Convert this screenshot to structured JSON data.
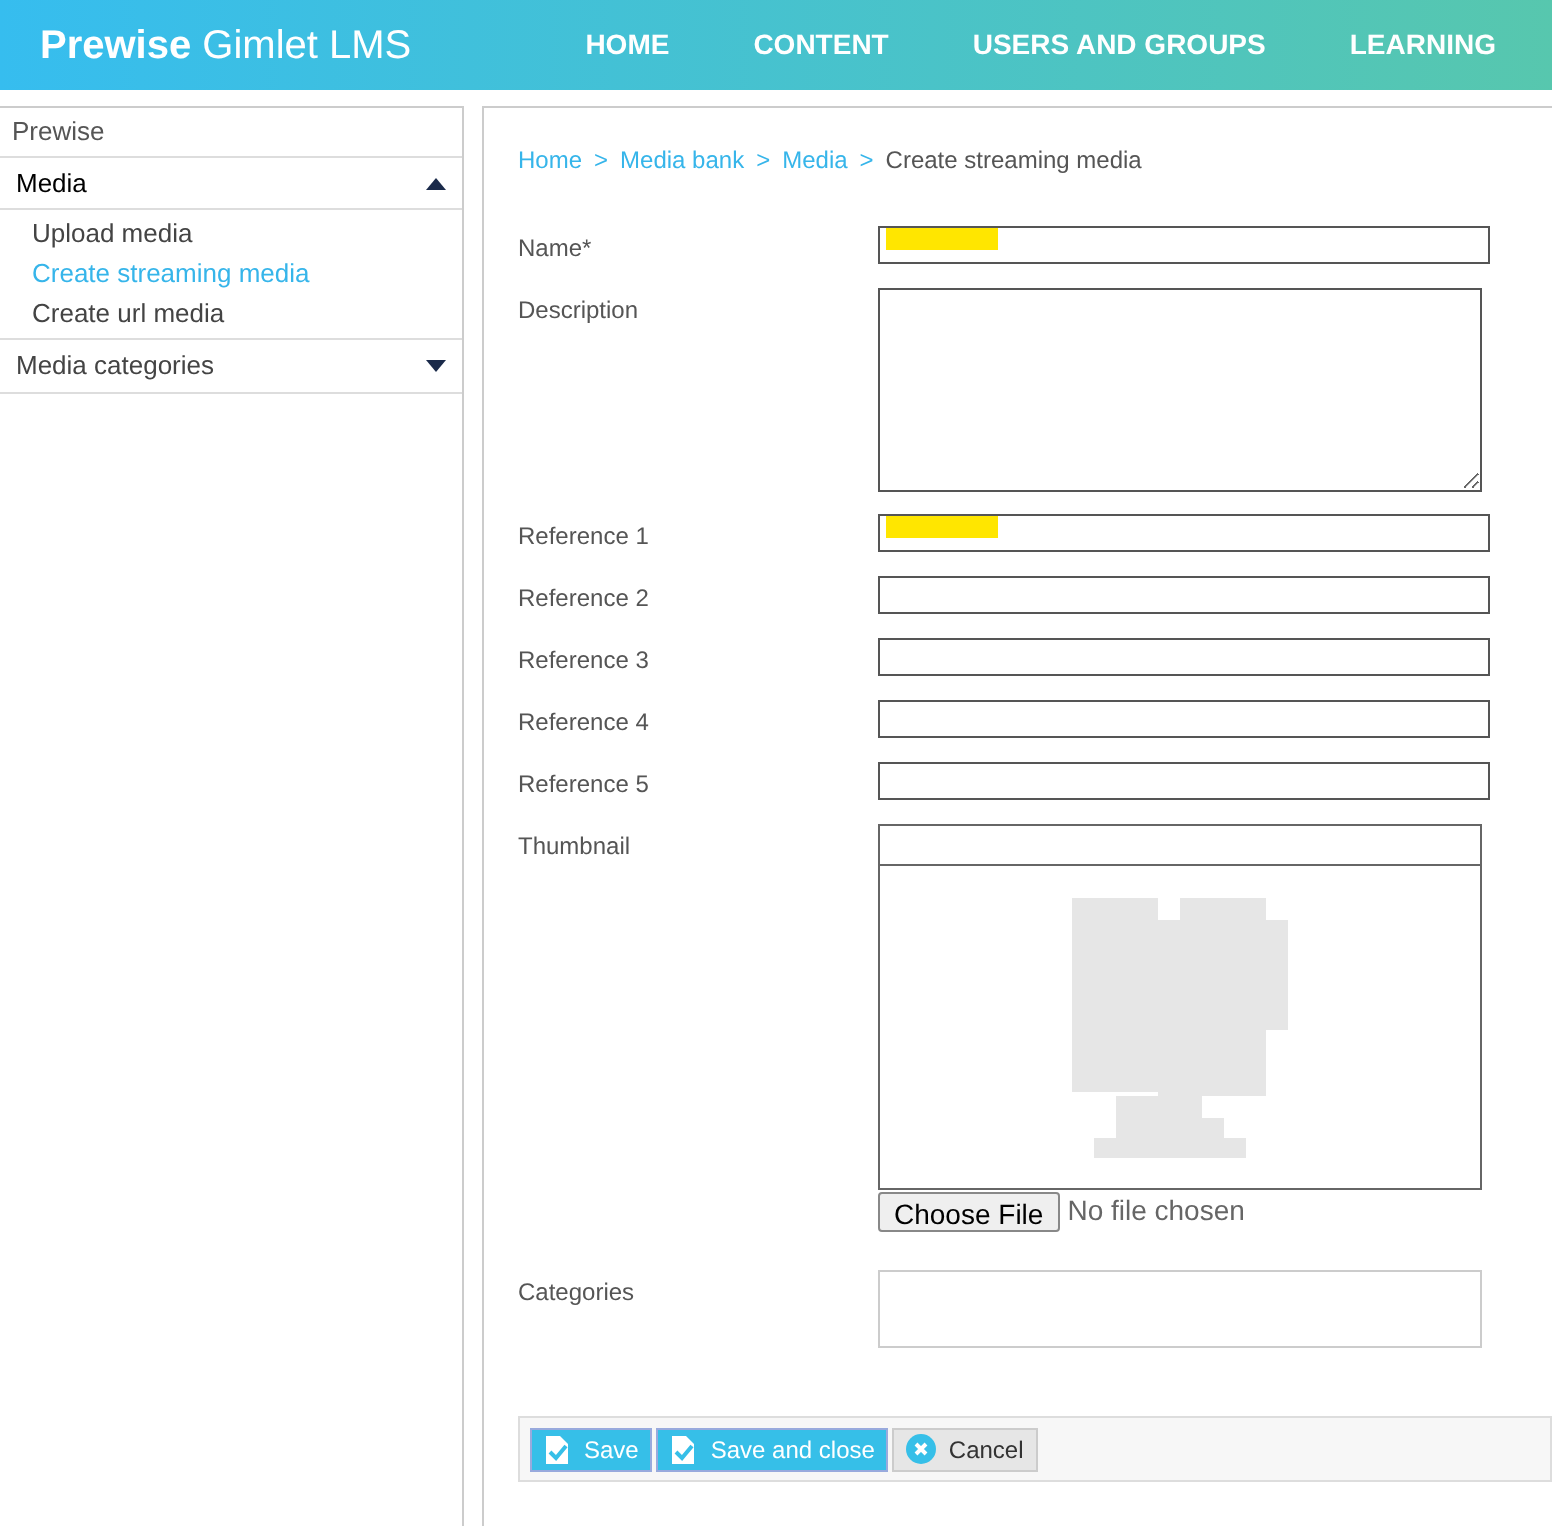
{
  "header": {
    "brand_bold": "Prewise",
    "brand_rest": "Gimlet LMS",
    "nav": [
      {
        "label": "HOME"
      },
      {
        "label": "CONTENT"
      },
      {
        "label": "USERS AND GROUPS"
      },
      {
        "label": "LEARNING"
      }
    ]
  },
  "sidebar": {
    "title": "Prewise",
    "groups": [
      {
        "label": "Media",
        "expanded": true,
        "children": [
          {
            "label": "Upload media",
            "selected": false
          },
          {
            "label": "Create streaming media",
            "selected": true
          },
          {
            "label": "Create url media",
            "selected": false
          }
        ]
      },
      {
        "label": "Media categories",
        "expanded": false
      }
    ]
  },
  "breadcrumb": [
    {
      "label": "Home",
      "link": true
    },
    {
      "label": "Media bank",
      "link": true
    },
    {
      "label": "Media",
      "link": true
    },
    {
      "label": "Create streaming media",
      "link": false
    }
  ],
  "breadcrumb_separator": ">",
  "fields": [
    {
      "kind": "text",
      "label": "Name*",
      "redacted": true
    },
    {
      "kind": "textarea",
      "label": "Description"
    },
    {
      "kind": "text",
      "label": "Reference 1",
      "redacted": true
    },
    {
      "kind": "text",
      "label": "Reference 2",
      "redacted": false
    },
    {
      "kind": "text",
      "label": "Reference 3",
      "redacted": false
    },
    {
      "kind": "text",
      "label": "Reference 4",
      "redacted": false
    },
    {
      "kind": "text",
      "label": "Reference 5",
      "redacted": false
    },
    {
      "kind": "file",
      "label": "Thumbnail",
      "button": "Choose File",
      "status": "No file chosen"
    },
    {
      "kind": "categories",
      "label": "Categories"
    }
  ],
  "actions": [
    {
      "kind": "save",
      "label": "Save"
    },
    {
      "kind": "save",
      "label": "Save and close"
    },
    {
      "kind": "cancel",
      "label": "Cancel"
    }
  ]
}
